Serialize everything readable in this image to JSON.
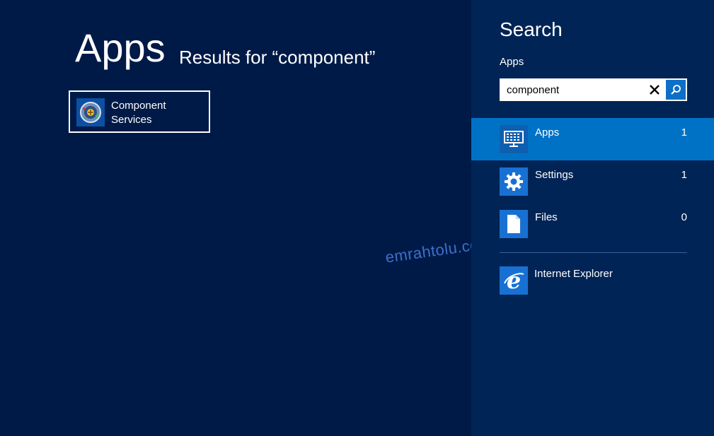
{
  "main": {
    "title": "Apps",
    "results_for": "Results for “component”",
    "results": [
      {
        "label": "Component Services",
        "icon": "component-services-icon"
      }
    ]
  },
  "watermark": "emrahtolu.com",
  "search_pane": {
    "title": "Search",
    "scope_label": "Apps",
    "search": {
      "value": "component",
      "placeholder": ""
    },
    "categories": [
      {
        "label": "Apps",
        "count": "1",
        "icon": "apps-icon",
        "selected": true
      },
      {
        "label": "Settings",
        "count": "1",
        "icon": "gear-icon",
        "selected": false
      },
      {
        "label": "Files",
        "count": "0",
        "icon": "file-icon",
        "selected": false
      }
    ],
    "apps": [
      {
        "label": "Internet Explorer",
        "icon": "internet-explorer-icon"
      }
    ]
  },
  "colors": {
    "background": "#001a47",
    "pane_background": "#012456",
    "selected": "#0072c6",
    "tile_blue": "#1871d2"
  }
}
